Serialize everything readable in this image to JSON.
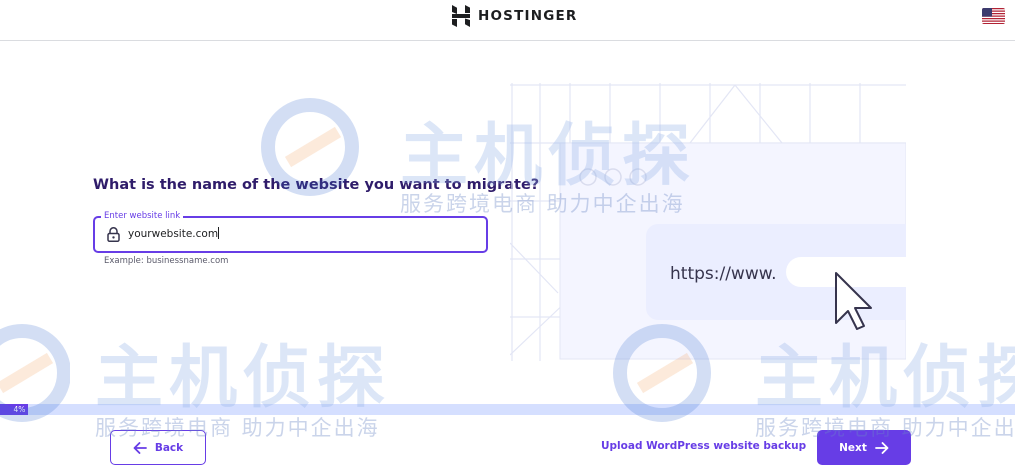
{
  "header": {
    "brand": "HOSTINGER",
    "logo_icon": "hostinger-logo-icon",
    "flag_icon": "us-flag-icon"
  },
  "main": {
    "question": "What is the name of the website you want to migrate?",
    "field": {
      "label": "Enter website link",
      "value": "yourwebsite.com",
      "icon": "lock-icon"
    },
    "helper": "Example: businessname.com"
  },
  "illustration": {
    "url_text": "https://www."
  },
  "progress": {
    "percent": 4,
    "label": "4%"
  },
  "footer": {
    "back_label": "Back",
    "upload_label": "Upload WordPress website backup",
    "next_label": "Next"
  },
  "watermark": {
    "title": "主机侦探",
    "subtitle": "服务跨境电商 助力中企出海"
  },
  "colors": {
    "primary": "#673de6",
    "heading": "#2f1c6a",
    "progress_track": "#d5dfff",
    "illustration_panel": "#ebeeff"
  }
}
